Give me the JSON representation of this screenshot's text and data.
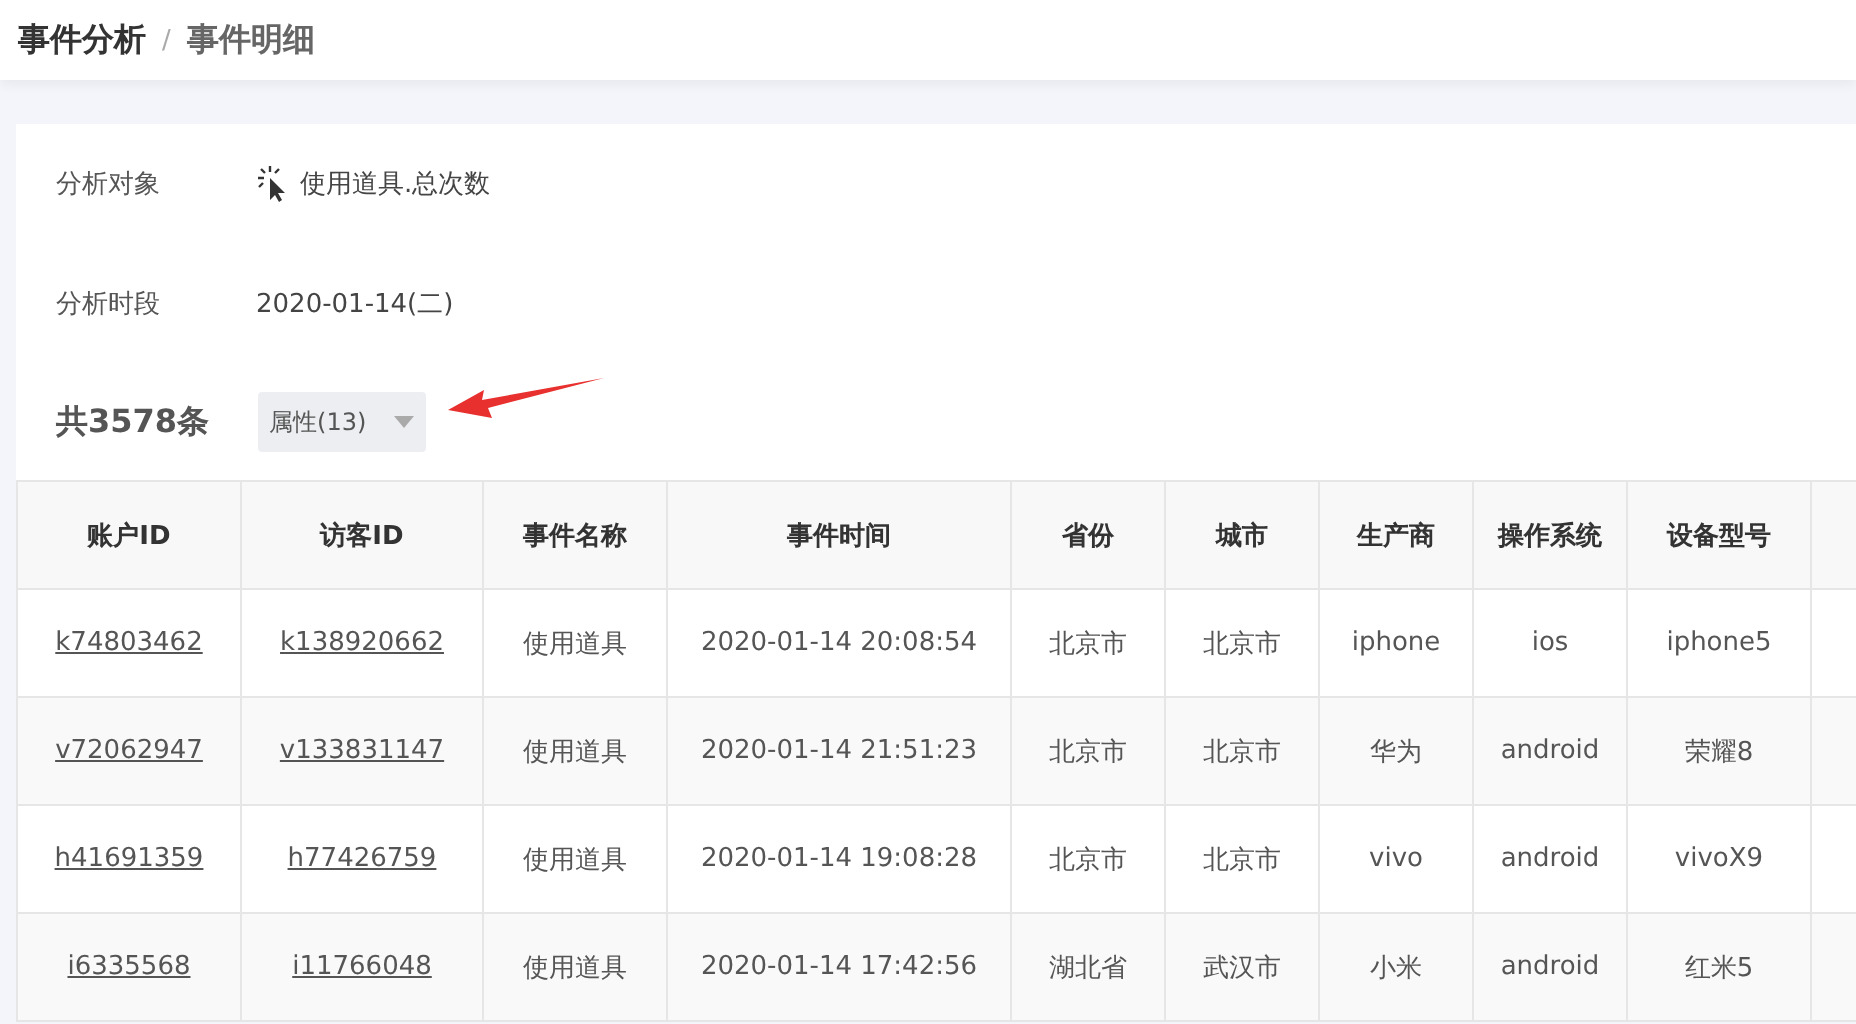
{
  "breadcrumb": [
    {
      "label": "事件分析"
    },
    {
      "label": "/"
    },
    {
      "label": "事件明细"
    }
  ],
  "info": [
    {
      "label": "分析对象",
      "value": "使用道具.总次数",
      "kind": "event"
    },
    {
      "label": "分析时段",
      "value": "2020-01-14(二)",
      "kind": "text"
    }
  ],
  "summary": {
    "count": "共3578条",
    "dropdown": "属性(13)"
  },
  "table": {
    "columns": [
      "账户ID",
      "访客ID",
      "事件名称",
      "事件时间",
      "省份",
      "城市",
      "生产商",
      "操作系统",
      "设备型号"
    ],
    "rows": [
      [
        "k74803462",
        "k138920662",
        "使用道具",
        "2020-01-14 20:08:54",
        "北京市",
        "北京市",
        "iphone",
        "ios",
        "iphone5"
      ],
      [
        "v72062947",
        "v133831147",
        "使用道具",
        "2020-01-14 21:51:23",
        "北京市",
        "北京市",
        "华为",
        "android",
        "荣耀8"
      ],
      [
        "h41691359",
        "h77426759",
        "使用道具",
        "2020-01-14 19:08:28",
        "北京市",
        "北京市",
        "vivo",
        "android",
        "vivoX9"
      ],
      [
        "i6335568",
        "i11766048",
        "使用道具",
        "2020-01-14 17:42:56",
        "湖北省",
        "武汉市",
        "小米",
        "android",
        "红米5"
      ]
    ]
  }
}
